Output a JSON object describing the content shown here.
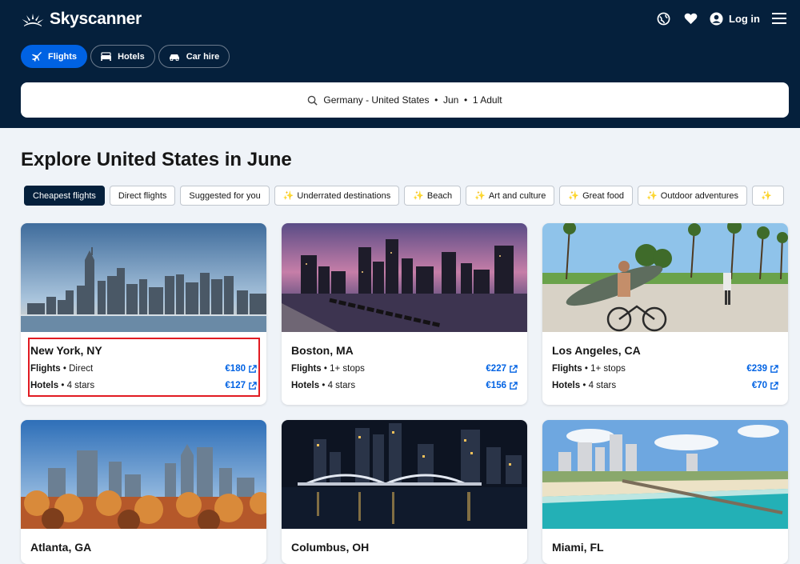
{
  "header": {
    "brand": "Skyscanner",
    "login_label": "Log in",
    "icons": [
      "globe-icon",
      "heart-icon",
      "user-icon",
      "menu-icon"
    ],
    "tabs": [
      {
        "label": "Flights",
        "icon": "plane-icon",
        "active": true
      },
      {
        "label": "Hotels",
        "icon": "bed-icon",
        "active": false
      },
      {
        "label": "Car hire",
        "icon": "car-icon",
        "active": false
      }
    ],
    "search_summary": "Germany - United States  •  Jun  •  1 Adult"
  },
  "main": {
    "title": "Explore United States in June",
    "chips": [
      "Cheapest flights",
      "Direct flights",
      "Suggested for you",
      "Underrated destinations",
      "Beach",
      "Art and culture",
      "Great food",
      "Outdoor adventures"
    ],
    "cards": [
      {
        "city": "New York, NY",
        "flights_label": "Flights",
        "flights_detail": "Direct",
        "flights_price": "€180",
        "hotels_label": "Hotels",
        "hotels_detail": "4 stars",
        "hotels_price": "€127"
      },
      {
        "city": "Boston, MA",
        "flights_label": "Flights",
        "flights_detail": "1+ stops",
        "flights_price": "€227",
        "hotels_label": "Hotels",
        "hotels_detail": "4 stars",
        "hotels_price": "€156"
      },
      {
        "city": "Los Angeles, CA",
        "flights_label": "Flights",
        "flights_detail": "1+ stops",
        "flights_price": "€239",
        "hotels_label": "Hotels",
        "hotels_detail": "4 stars",
        "hotels_price": "€70"
      },
      {
        "city": "Atlanta, GA"
      },
      {
        "city": "Columbus, OH"
      },
      {
        "city": "Miami, FL"
      }
    ]
  },
  "colors": {
    "header_bg": "#05203c",
    "accent": "#0062e3",
    "highlight": "#e11b22"
  }
}
